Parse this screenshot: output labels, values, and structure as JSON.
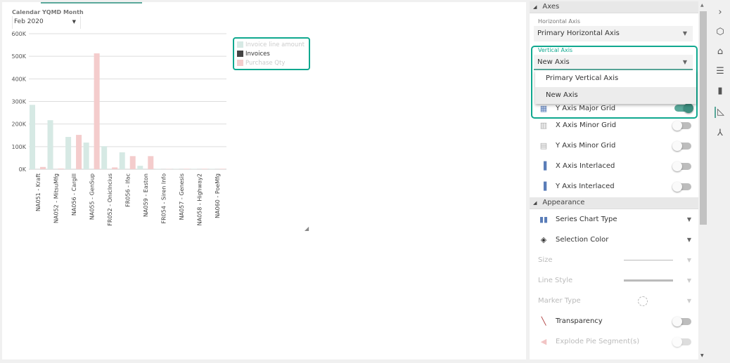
{
  "filter": {
    "label": "Calendar YQMD Month",
    "value": "Feb 2020"
  },
  "chart_data": {
    "type": "bar",
    "categories": [
      "NA051 - Kraft",
      "NA052 - MitsuMfg",
      "NA056 - Cargill",
      "NA055 - GenSup",
      "FR052 - OnicIncius",
      "FR056 - Ifac",
      "NA059 - Easton",
      "FR054 - Siren Info",
      "NA057 - Genesis",
      "NA058 - Highway2",
      "NA060 - PoeMfg"
    ],
    "series": [
      {
        "name": "Invoice line amount",
        "color": "#d6e9e4",
        "values": [
          285000,
          217000,
          143000,
          118000,
          102000,
          75000,
          15000,
          2000,
          1000,
          1000,
          1000
        ]
      },
      {
        "name": "Invoices",
        "color": "#444444",
        "values": []
      },
      {
        "name": "Purchase Qty",
        "color": "#f4cccc",
        "values": [
          10000,
          3000,
          152000,
          513000,
          8000,
          58000,
          58000,
          1000,
          2000,
          2000,
          2000
        ]
      }
    ],
    "yticks": [
      "0K",
      "100K",
      "200K",
      "300K",
      "400K",
      "500K",
      "600K"
    ],
    "ylim": [
      0,
      600000
    ],
    "grid": true,
    "legend": "top-right"
  },
  "panel": {
    "axes": "Axes",
    "h_label": "Horizontal Axis",
    "h_value": "Primary Horizontal Axis",
    "v_label": "Vertical Axis",
    "v_value": "New Axis",
    "options": [
      "Primary Vertical Axis",
      "New Axis"
    ],
    "hidden_row": "Y Axis Major Grid",
    "rows": [
      "X Axis Minor Grid",
      "Y Axis Minor Grid",
      "X Axis Interlaced",
      "Y Axis Interlaced"
    ],
    "appearance": "Appearance",
    "series_type": "Series Chart Type",
    "selection_color": "Selection Color",
    "size": "Size",
    "line_style": "Line Style",
    "marker_type": "Marker Type",
    "transparency": "Transparency",
    "explode": "Explode Pie Segment(s)"
  }
}
